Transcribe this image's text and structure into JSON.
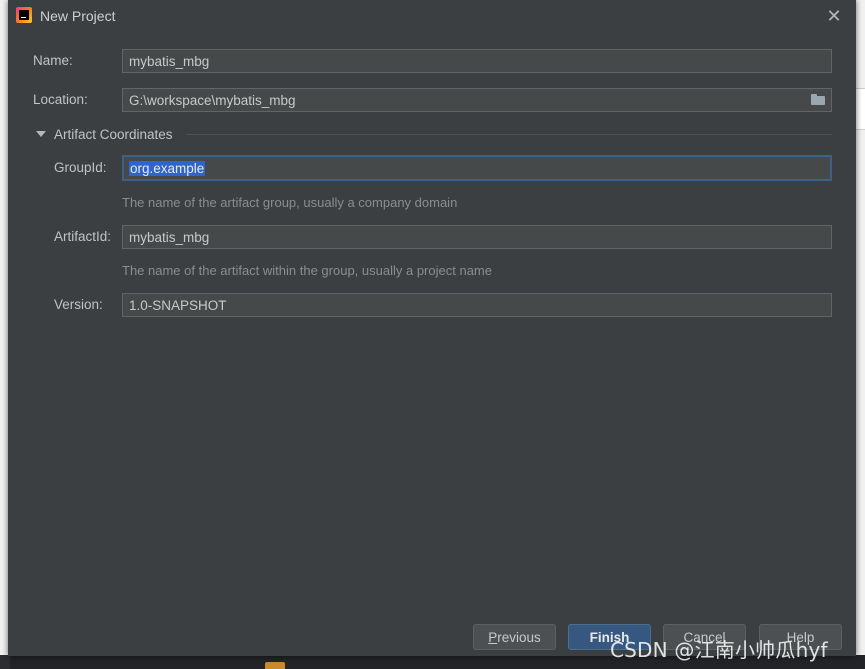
{
  "dialog": {
    "title": "New Project",
    "close_glyph": "✕"
  },
  "form": {
    "name_label": "Name:",
    "name_value": "mybatis_mbg",
    "location_label": "Location:",
    "location_value": "G:\\workspace\\mybatis_mbg",
    "section_title": "Artifact Coordinates",
    "groupid_label": "GroupId:",
    "groupid_value": "org.example",
    "groupid_hint": "The name of the artifact group, usually a company domain",
    "artifactid_label": "ArtifactId:",
    "artifactid_value": "mybatis_mbg",
    "artifactid_hint": "The name of the artifact within the group, usually a project name",
    "version_label": "Version:",
    "version_value": "1.0-SNAPSHOT"
  },
  "buttons": {
    "previous_mnemonic": "P",
    "previous_rest": "revious",
    "finish_label": "Finish",
    "cancel_label": "Cancel",
    "help_label": "Help"
  },
  "watermark": "CSDN @江南小帅瓜hyf",
  "icons": {
    "app": "intellij-idea-icon",
    "close": "close-icon",
    "folder": "folder-icon",
    "collapse": "triangle-down-icon"
  },
  "colors": {
    "dialog_bg": "#3c3f41",
    "field_bg": "#45494a",
    "focus_border": "#3d6185",
    "selection": "#2f65ca",
    "primary_button": "#365880"
  }
}
